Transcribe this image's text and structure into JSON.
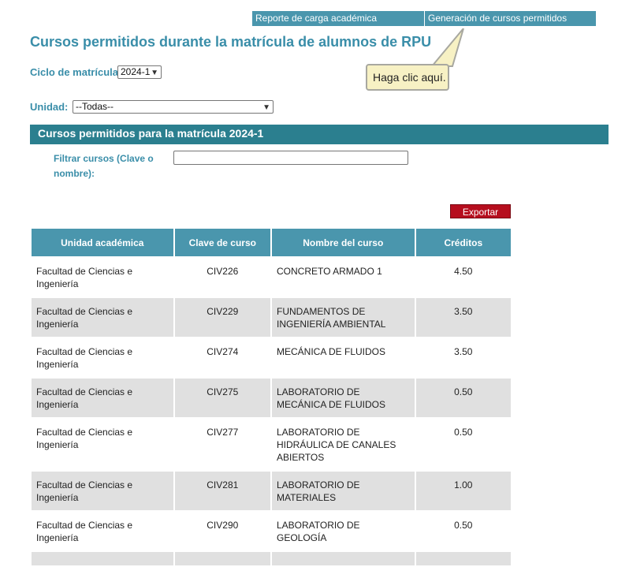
{
  "nav": {
    "report_link": "Reporte de carga académica",
    "generate_link": "Generación de cursos permitidos"
  },
  "page_title": "Cursos permitidos durante la matrícula de alumnos de RPU",
  "ciclo": {
    "label": "Ciclo de matrícula:",
    "value": "2024-1"
  },
  "unidad": {
    "label": "Unidad:",
    "value": "--Todas--"
  },
  "callout": {
    "text": "Haga clic aquí."
  },
  "section_title": "Cursos permitidos para la matrícula 2024-1",
  "filter": {
    "label": "Filtrar cursos (Clave o nombre):",
    "value": ""
  },
  "export_label": "Exportar",
  "table": {
    "headers": [
      "Unidad académica",
      "Clave de curso",
      "Nombre del curso",
      "Créditos"
    ],
    "rows": [
      [
        "Facultad de Ciencias e Ingeniería",
        "CIV226",
        "CONCRETO ARMADO 1",
        "4.50"
      ],
      [
        "Facultad de Ciencias e Ingeniería",
        "CIV229",
        "FUNDAMENTOS DE INGENIERÍA AMBIENTAL",
        "3.50"
      ],
      [
        "Facultad de Ciencias e Ingeniería",
        "CIV274",
        "MECÁNICA DE FLUIDOS",
        "3.50"
      ],
      [
        "Facultad de Ciencias e Ingeniería",
        "CIV275",
        "LABORATORIO DE MECÁNICA DE FLUIDOS",
        "0.50"
      ],
      [
        "Facultad de Ciencias e Ingeniería",
        "CIV277",
        "LABORATORIO DE HIDRÁULICA DE CANALES ABIERTOS",
        "0.50"
      ],
      [
        "Facultad de Ciencias e Ingeniería",
        "CIV281",
        "LABORATORIO DE MATERIALES",
        "1.00"
      ],
      [
        "Facultad de Ciencias e Ingeniería",
        "CIV290",
        "LABORATORIO DE GEOLOGÍA",
        "0.50"
      ],
      [
        "",
        "",
        "",
        ""
      ]
    ]
  }
}
